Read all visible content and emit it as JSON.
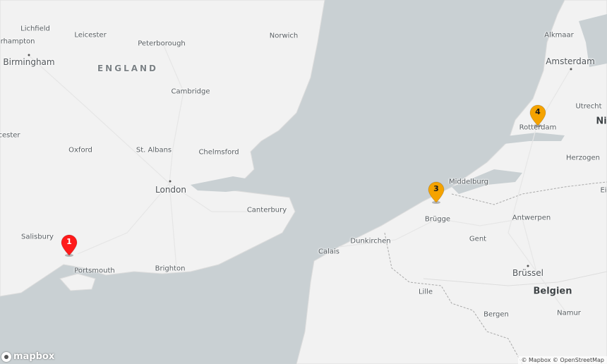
{
  "labels": {
    "lichfield": "Lichfield",
    "leicester": "Leicester",
    "norwich": "Norwich",
    "alkmaar": "Alkmaar",
    "wolverhampton": "erhampton",
    "peterborough": "Peterborough",
    "birmingham": "Birmingham",
    "england": "ENGLAND",
    "amsterdam": "Amsterdam",
    "cambridge": "Cambridge",
    "utrecht": "Utrecht",
    "ni": "Ni",
    "rotterdam": "Rotterdam",
    "cester": "cester",
    "oxford": "Oxford",
    "st_albans": "St. Albans",
    "chelmsford": "Chelmsford",
    "herzogen": "Herzogen",
    "london": "London",
    "middelburg": "Middelburg",
    "ei": "Ei",
    "canterbury": "Canterbury",
    "brugge": "Brügge",
    "antwerpen": "Antwerpen",
    "salisbury": "Salisbury",
    "dunkirchen": "Dunkirchen",
    "calais": "Calais",
    "gent": "Gent",
    "portsmouth": "Portsmouth",
    "brighton": "Brighton",
    "brussel": "Brüssel",
    "belgien": "Belgien",
    "lille": "Lille",
    "namur": "Namur",
    "bergen": "Bergen"
  },
  "markers": [
    {
      "number": "1",
      "color": "#ff1a1a",
      "text_color": "#ffffff"
    },
    {
      "number": "3",
      "color": "#f5a300",
      "text_color": "#1a1a1a"
    },
    {
      "number": "4",
      "color": "#f5a300",
      "text_color": "#1a1a1a"
    }
  ],
  "logo": {
    "text": "mapbox"
  },
  "attribution": {
    "mapbox": "© Mapbox",
    "osm": "© OpenStreetMap"
  }
}
